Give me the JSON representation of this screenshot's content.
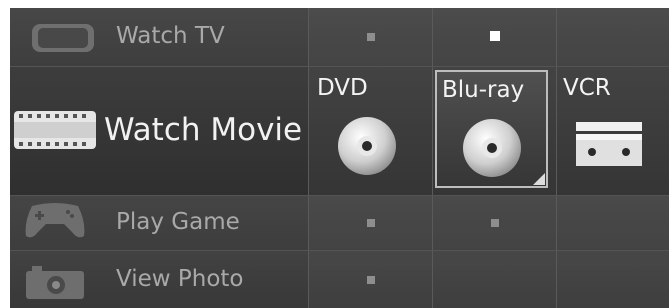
{
  "menu": {
    "rows": [
      {
        "label": "Watch TV",
        "icon": "tv-icon"
      },
      {
        "label": "Watch Movie",
        "icon": "film-icon"
      },
      {
        "label": "Play Game",
        "icon": "gamepad-icon"
      },
      {
        "label": "View Photo",
        "icon": "camera-icon"
      }
    ]
  },
  "movie_options": [
    {
      "label": "DVD",
      "icon": "disc-icon"
    },
    {
      "label": "Blu-ray",
      "icon": "disc-icon",
      "selected": true
    },
    {
      "label": "VCR",
      "icon": "vcr-icon"
    }
  ],
  "colors": {
    "background": "#3a3a3a",
    "highlight_text": "#f2f2f2",
    "dim_text": "#a9a9a9",
    "selection_border": "#bdbdbd"
  }
}
